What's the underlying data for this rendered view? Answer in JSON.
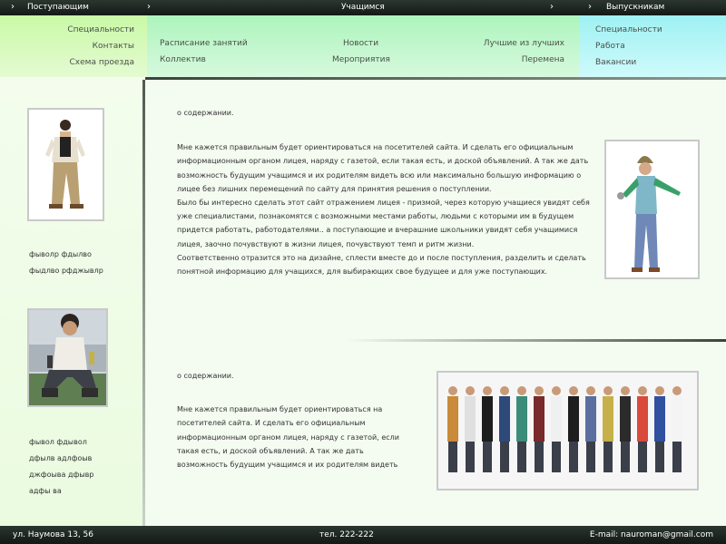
{
  "nav": {
    "sections": [
      {
        "label": "Поступающим",
        "arrow": "›"
      },
      {
        "label": "Учащимся",
        "arrow": "›"
      },
      {
        "label": "Выпускникам",
        "arrow": "›"
      }
    ]
  },
  "menus": {
    "applicants": [
      "Специальности",
      "Контакты",
      "Схема проезда"
    ],
    "students": [
      "Расписание занятий",
      "Коллектив",
      "Новости",
      "Мероприятия",
      "Лучшие из лучших",
      "Перемена"
    ],
    "graduates": [
      "Специальности",
      "Работа",
      "Вакансии"
    ]
  },
  "sidebar": {
    "block1": [
      "фыволр фдылво",
      "фыдлво рфджывлр"
    ],
    "block2": [
      "фывол фдывол",
      "дфылв адлфоыв",
      "джфоыва дфывр",
      "адфы ва"
    ]
  },
  "content": {
    "block1": {
      "heading": "о содержании.",
      "lines": [
        "Мне кажется правильным будет ориентироваться на посетителей сайта. И сделать его официальным",
        "информационным органом лицея, наряду с газетой, если такая есть, и доской объявлений.   А так же дать",
        "возможность будущим учащимся и их родителям видеть всю или максимально большую информацию о",
        "лицее без лишних перемещений по сайту для принятия решения о поступлении.",
        "Было бы интересно сделать этот сайт отражением лицея - призмой, через которую учащиеся увидят себя",
        "уже специалистами, познакомятся с возможными местами работы, людьми с которыми им в будущем",
        "придется работать, работодателями.. а поступающие и вчерашние школьники увидят себя учащимися",
        "лицея, заочно почувствуют   в жизни лицея, почувствуют темп и ритм жизни.",
        "Соответственно отразится это на дизайне, сплести вместе до и после поступления, разделить и сделать",
        "понятной информацию для учащихся, для выбирающих свое будущее и для уже поступающих."
      ]
    },
    "block2": {
      "heading": "о содержании.",
      "lines": [
        "Мне кажется правильным будет ориентироваться на",
        "посетителей сайта. И сделать его официальным",
        "информационным органом лицея, наряду с газетой, если",
        "такая есть, и доской объявлений.   А так же дать",
        "возможность будущим учащимся и их родителям видеть"
      ]
    }
  },
  "footer": {
    "address": "ул. Наумова 13, 56",
    "phone": "тел. 222-222",
    "email": "E-mail: nauroman@gmail.com"
  },
  "colors": {
    "menu_applicants": "#c9f9a6",
    "menu_students": "#adf4bd",
    "menu_graduates": "#9ef1f3",
    "bar": "#1c2420"
  }
}
